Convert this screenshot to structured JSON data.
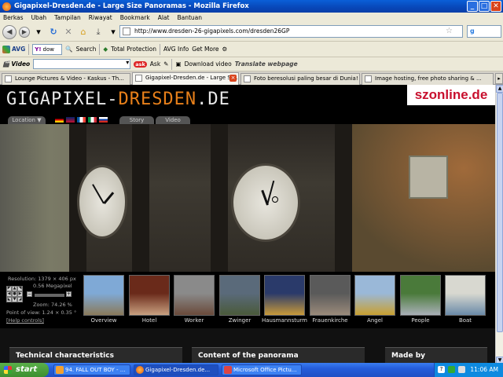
{
  "window": {
    "title": "Gigapixel-Dresden.de - Large Size Panoramas - Mozilla Firefox",
    "controls": [
      "_",
      "□",
      "✕"
    ]
  },
  "menu": [
    "Berkas",
    "Ubah",
    "Tampilan",
    "Riwayat",
    "Bookmark",
    "Alat",
    "Bantuan"
  ],
  "nav": {
    "url": "http://www.dresden-26-gigapixels.com/dresden26GP",
    "search_engine": "g"
  },
  "avg_toolbar": {
    "brand": "AVG",
    "yahoo_text": "dow",
    "search": "Search",
    "total_protection": "Total Protection",
    "avg_info": "AVG Info",
    "get_more": "Get More"
  },
  "video_toolbar": {
    "label": "Video",
    "ask": "ask",
    "ask_label": "Ask",
    "download": "Download video",
    "translate": "Translate webpage"
  },
  "tabs": [
    {
      "label": "Lounge Pictures & Video - Kaskus - Th..."
    },
    {
      "label": "Gigapixel-Dresden.de - Large Si...",
      "active": true
    },
    {
      "label": "Foto beresolusi paling besar di Dunia!"
    },
    {
      "label": "Image hosting, free photo sharing & ..."
    }
  ],
  "site": {
    "logo_main": "GIGAPIXEL-",
    "logo_accent": "DRESDEN",
    "logo_tld": ".DE",
    "partner": "szonline.de",
    "nav_location": "Location ▼",
    "nav_story": "Story",
    "nav_video": "Video"
  },
  "viewer": {
    "resolution": "Resolution: 1379 × 406 px",
    "megapixel": "0.56 Megapixel",
    "zoom": "Zoom: 74.26 %",
    "pov": "Point of view: 1.24 × 0.35 °",
    "help": "[Help controls]"
  },
  "thumbnails": [
    {
      "label": "Overview",
      "color1": "#7fa9d6",
      "color2": "#8a7a5a"
    },
    {
      "label": "Hotel",
      "color1": "#6a2a1a",
      "color2": "#c9a080"
    },
    {
      "label": "Worker",
      "color1": "#8a8a8a",
      "color2": "#6a4a3a"
    },
    {
      "label": "Zwinger",
      "color1": "#5a6a7a",
      "color2": "#4a5a3a"
    },
    {
      "label": "Hausmannsturm",
      "color1": "#2a3a6a",
      "color2": "#c89a3a"
    },
    {
      "label": "Frauenkirche",
      "color1": "#5a5a5a",
      "color2": "#9a8a7a"
    },
    {
      "label": "Angel",
      "color1": "#9ab8d8",
      "color2": "#c9a030"
    },
    {
      "label": "People",
      "color1": "#4a7a3a",
      "color2": "#aab0b8"
    },
    {
      "label": "Boat",
      "color1": "#d8d8d0",
      "color2": "#6a8aa8"
    }
  ],
  "panels": [
    {
      "label": "Technical characteristics"
    },
    {
      "label": "Content of the panorama"
    },
    {
      "label": "Made by"
    }
  ],
  "taskbar": {
    "start": "start",
    "items": [
      {
        "label": "94. FALL OUT BOY - ..."
      },
      {
        "label": "Gigapixel-Dresden.de..."
      },
      {
        "label": "Microsoft Office Pictu..."
      }
    ],
    "clock": "11:06 AM"
  },
  "colors": {
    "accent": "#e8801a",
    "partner_red": "#c8102e",
    "xp_blue": "#245ddb"
  }
}
